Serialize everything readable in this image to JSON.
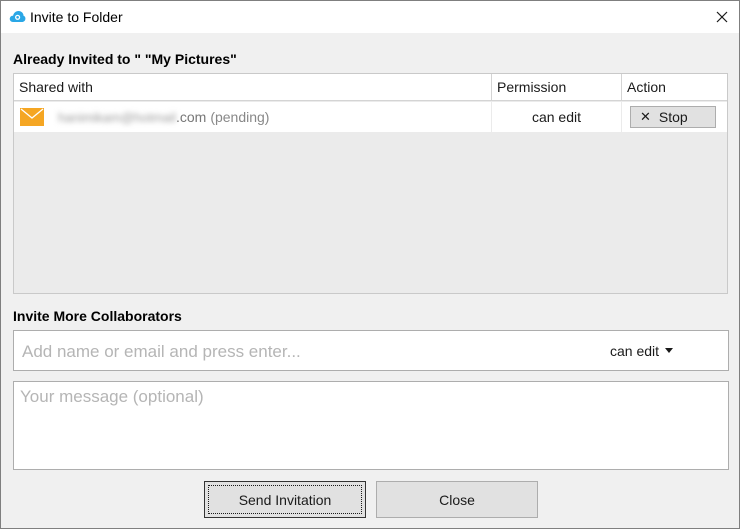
{
  "window": {
    "title": "Invite to Folder",
    "app_icon": "cloud-app-icon",
    "close_icon": "close-icon"
  },
  "already_invited": {
    "heading": "Already Invited to \" \"My Pictures\""
  },
  "table": {
    "columns": [
      "Shared with",
      "Permission",
      "Action"
    ],
    "rows": [
      {
        "icon": "mail-icon",
        "email_blurred": "hanimikam@hotmail",
        "email_domain": ".com",
        "status": "(pending)",
        "permission": "can edit",
        "action_label": "Stop",
        "action_icon": "x-icon"
      }
    ]
  },
  "invite_more": {
    "heading": "Invite More Collaborators",
    "input_placeholder": "Add name or email and press enter...",
    "permission_selected": "can edit",
    "message_placeholder": "Your message (optional)"
  },
  "buttons": {
    "send": "Send Invitation",
    "close": "Close"
  },
  "colors": {
    "mail_icon": "#f5a623",
    "app_icon": "#2aa7e6"
  }
}
